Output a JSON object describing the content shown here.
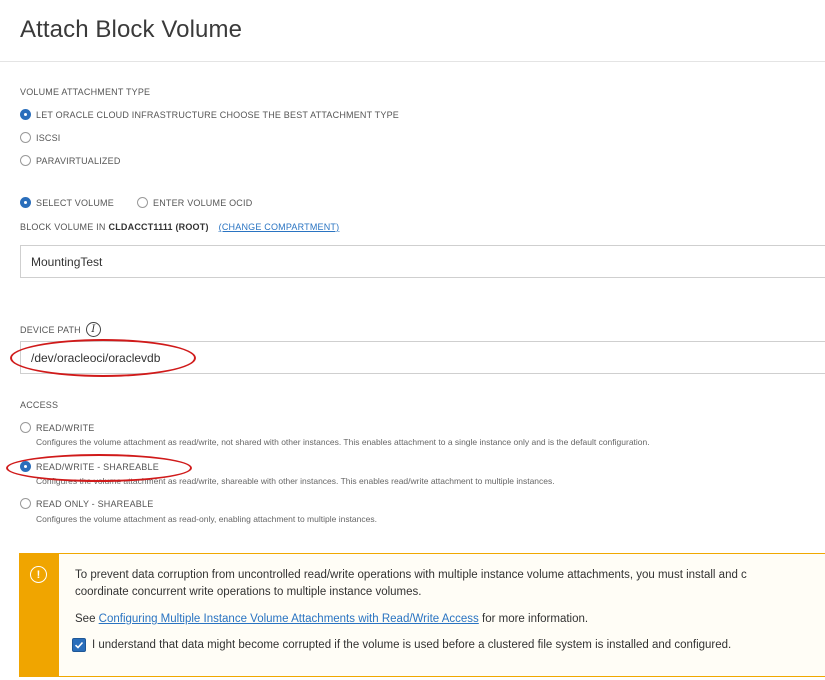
{
  "header": {
    "title": "Attach Block Volume"
  },
  "attachment_type": {
    "label": "VOLUME ATTACHMENT TYPE",
    "options": [
      {
        "label": "LET ORACLE CLOUD INFRASTRUCTURE CHOOSE THE BEST ATTACHMENT TYPE",
        "selected": true
      },
      {
        "label": "ISCSI",
        "selected": false
      },
      {
        "label": "PARAVIRTUALIZED",
        "selected": false
      }
    ]
  },
  "volume_select": {
    "options": [
      {
        "label": "SELECT VOLUME",
        "selected": true
      },
      {
        "label": "ENTER VOLUME OCID",
        "selected": false
      }
    ],
    "compartment_prefix": "BLOCK VOLUME IN",
    "compartment_name": "CLDACCT1111 (ROOT)",
    "change_link": "(CHANGE COMPARTMENT)",
    "value": "MountingTest"
  },
  "device_path": {
    "label": "DEVICE PATH",
    "info_icon": "i",
    "value": "/dev/oracleoci/oraclevdb"
  },
  "access": {
    "label": "ACCESS",
    "options": [
      {
        "label": "READ/WRITE",
        "selected": false,
        "description": "Configures the volume attachment as read/write, not shared with other instances. This enables attachment to a single instance only and is the default configuration."
      },
      {
        "label": "READ/WRITE - SHAREABLE",
        "selected": true,
        "description": "Configures the volume attachment as read/write, shareable with other instances. This enables read/write attachment to multiple instances."
      },
      {
        "label": "READ ONLY - SHAREABLE",
        "selected": false,
        "description": "Configures the volume attachment as read-only, enabling attachment to multiple instances."
      }
    ]
  },
  "warning": {
    "icon": "!",
    "line1": "To prevent data corruption from uncontrolled read/write operations with multiple instance volume attachments, you must install and c",
    "line2": "coordinate concurrent write operations to multiple instance volumes.",
    "see_prefix": "See",
    "link": "Configuring Multiple Instance Volume Attachments with Read/Write Access",
    "see_suffix": "for more information.",
    "checkbox_label": "I understand that data might become corrupted if the volume is used before a clustered file system is installed and configured.",
    "checkbox_checked": true
  },
  "colors": {
    "accent": "#2a6ebb",
    "warning": "#f0a500",
    "annotation": "#d01a1a"
  }
}
